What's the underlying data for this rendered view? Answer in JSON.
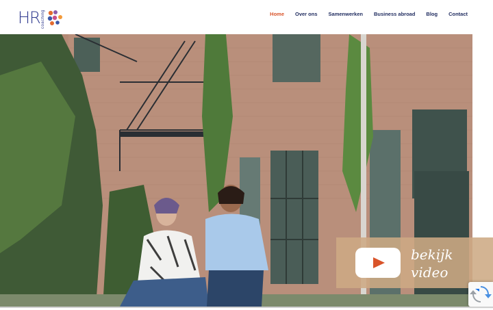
{
  "logo": {
    "text": "HR",
    "subtext": "coaching",
    "icon": "hr-logo-dots-icon",
    "dot_colors": [
      "#e36b2f",
      "#8e5ba8",
      "#3c58a8",
      "#f39a3a",
      "#c94f8a"
    ]
  },
  "nav": {
    "items": [
      {
        "label": "Home",
        "active": true
      },
      {
        "label": "Over ons",
        "active": false
      },
      {
        "label": "Samenwerken",
        "active": false
      },
      {
        "label": "Business abroad",
        "active": false
      },
      {
        "label": "Blog",
        "active": false
      },
      {
        "label": "Contact",
        "active": false
      }
    ]
  },
  "video": {
    "line1": "bekijk",
    "line2": "video",
    "icon": "play-icon"
  },
  "recaptcha": {
    "icon": "recaptcha-icon"
  },
  "colors": {
    "accent": "#d9542a",
    "nav_text": "#1e2a5e",
    "logo_blue": "#2f3a8f",
    "video_panel": "#cdaa84"
  }
}
